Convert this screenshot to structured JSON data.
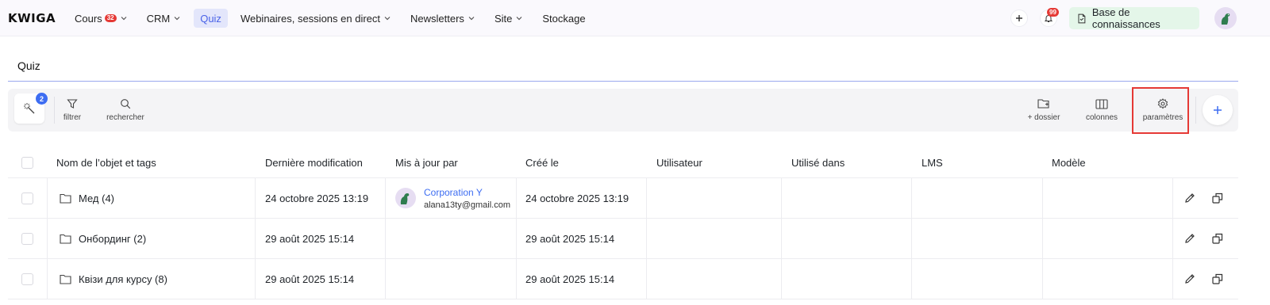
{
  "app": {
    "logo": "KWIGA"
  },
  "nav": {
    "items": [
      {
        "label": "Cours",
        "badge": "32",
        "dropdown": true
      },
      {
        "label": "CRM",
        "dropdown": true
      },
      {
        "label": "Quiz",
        "active": true
      },
      {
        "label": "Webinaires, sessions en direct",
        "dropdown": true
      },
      {
        "label": "Newsletters",
        "dropdown": true
      },
      {
        "label": "Site",
        "dropdown": true
      },
      {
        "label": "Stockage"
      }
    ],
    "notifications_count": "99",
    "knowledge_base_label": "Base de connaissances"
  },
  "page": {
    "title": "Quiz"
  },
  "toolbar": {
    "magic_badge": "2",
    "filter_label": "filtrer",
    "search_label": "rechercher",
    "add_folder_label": "+ dossier",
    "columns_label": "colonnes",
    "settings_label": "paramètres"
  },
  "table": {
    "columns": [
      "Nom de l’objet et tags",
      "Dernière modification",
      "Mis à jour par",
      "Créé le",
      "Utilisateur",
      "Utilisé dans",
      "LMS",
      "Modèle"
    ],
    "rows": [
      {
        "name": "Мед (4)",
        "modified": "24 octobre 2025 13:19",
        "updated_by_name": "Corporation Y",
        "updated_by_email": "alana13ty@gmail.com",
        "created": "24 octobre 2025 13:19"
      },
      {
        "name": "Онбординг (2)",
        "modified": "29 août 2025 15:14",
        "updated_by_name": "",
        "updated_by_email": "",
        "created": "29 août 2025 15:14"
      },
      {
        "name": "Квізи для курсу (8)",
        "modified": "29 août 2025 15:14",
        "updated_by_name": "",
        "updated_by_email": "",
        "created": "29 août 2025 15:14"
      }
    ]
  },
  "colors": {
    "accent": "#3d6df2",
    "active_nav_bg": "#e3e6fb",
    "highlight": "#e53935",
    "kb_bg": "#e4f6e9"
  }
}
